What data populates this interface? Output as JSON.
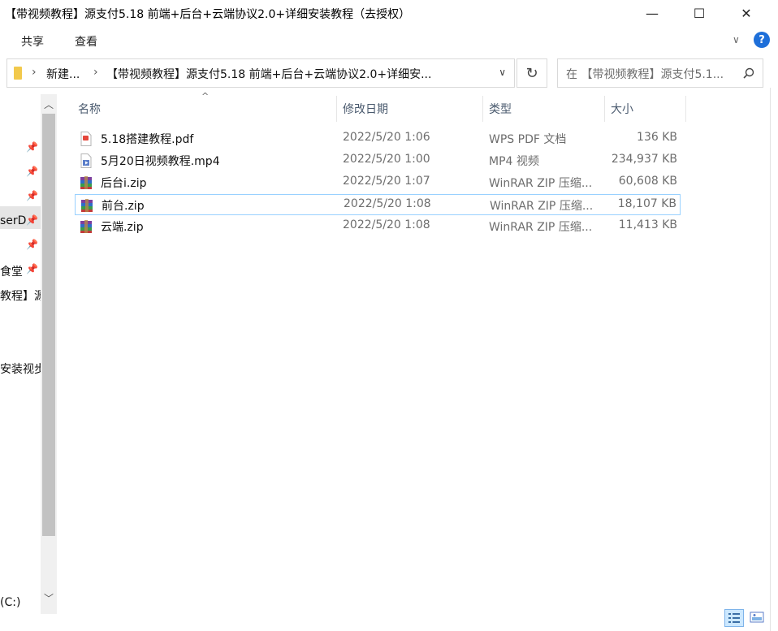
{
  "window": {
    "title": "【带视频教程】源支付5.18 前端+后台+云端协议2.0+详细安装教程（去授权）",
    "minimize_symbol": "—",
    "maximize_symbol": "☐",
    "close_symbol": "✕"
  },
  "ribbon": {
    "tabs": [
      "共享",
      "查看"
    ],
    "expand_symbol": "∨",
    "help_symbol": "?"
  },
  "address": {
    "crumbs": [
      "新建...",
      "【带视频教程】源支付5.18 前端+后台+云端协议2.0+详细安..."
    ],
    "separator": "›",
    "dropdown_symbol": "∨",
    "refresh_symbol": "↻"
  },
  "search": {
    "placeholder": "在 【带视频教程】源支付5.1..."
  },
  "nav_pane": {
    "items": [
      {
        "label": "",
        "pinned": false
      },
      {
        "label": "",
        "pinned": true
      },
      {
        "label": "",
        "pinned": true
      },
      {
        "label": "",
        "pinned": true
      },
      {
        "label": "serD",
        "pinned": true
      },
      {
        "label": "",
        "pinned": true
      },
      {
        "label": "食堂",
        "pinned": true
      },
      {
        "label": "教程】源",
        "pinned": false
      },
      {
        "label": "安装视步",
        "pinned": false
      },
      {
        "label": "(C:)",
        "pinned": false
      }
    ],
    "pin_symbol": "📌",
    "scroll_up": "︿",
    "scroll_down": "﹀"
  },
  "columns": {
    "name": "名称",
    "date": "修改日期",
    "type": "类型",
    "size": "大小",
    "sort_indicator": "^"
  },
  "files": [
    {
      "name": "5.18搭建教程.pdf",
      "date": "2022/5/20 1:06",
      "type": "WPS PDF 文档",
      "size": "136 KB",
      "icon": "pdf-icon"
    },
    {
      "name": "5月20日视频教程.mp4",
      "date": "2022/5/20 1:00",
      "type": "MP4 视频",
      "size": "234,937 KB",
      "icon": "video-file-icon"
    },
    {
      "name": "后台i.zip",
      "date": "2022/5/20 1:07",
      "type": "WinRAR ZIP 压缩...",
      "size": "60,608 KB",
      "icon": "winrar-icon"
    },
    {
      "name": "前台.zip",
      "date": "2022/5/20 1:08",
      "type": "WinRAR ZIP 压缩...",
      "size": "18,107 KB",
      "icon": "winrar-icon",
      "selected": true
    },
    {
      "name": "云端.zip",
      "date": "2022/5/20 1:08",
      "type": "WinRAR ZIP 压缩...",
      "size": "11,413 KB",
      "icon": "winrar-icon"
    }
  ],
  "colors": {
    "accent": "#1e6fd9",
    "selection_border": "#99d1ff",
    "header_text": "#4a5a6e",
    "meta_text": "#6d6d6d"
  }
}
